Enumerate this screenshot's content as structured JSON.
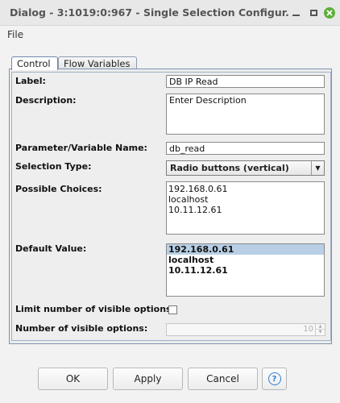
{
  "window": {
    "title": "Dialog - 3:1019:0:967 - Single Selection Configur...",
    "close_color": "#5fae3b"
  },
  "menu": {
    "file": "File"
  },
  "tabs": [
    {
      "label": "Control",
      "active": true
    },
    {
      "label": "Flow Variables",
      "active": false
    }
  ],
  "form": {
    "label": {
      "label": "Label:",
      "value": "DB IP Read"
    },
    "description": {
      "label": "Description:",
      "value": "Enter Description"
    },
    "parameter": {
      "label": "Parameter/Variable Name:",
      "value": "db_read"
    },
    "selection_type": {
      "label": "Selection Type:",
      "value": "Radio buttons (vertical)"
    },
    "possible_choices": {
      "label": "Possible Choices:",
      "items": [
        "192.168.0.61",
        "localhost",
        "10.11.12.61"
      ]
    },
    "default_value": {
      "label": "Default Value:",
      "items": [
        "192.168.0.61",
        "localhost",
        "10.11.12.61"
      ],
      "selected": "192.168.0.61"
    },
    "limit_visible": {
      "label": "Limit number of visible options:",
      "checked": false
    },
    "num_visible": {
      "label": "Number of visible options:",
      "value": "10"
    }
  },
  "buttons": {
    "ok": "OK",
    "apply": "Apply",
    "cancel": "Cancel",
    "help": "?"
  }
}
